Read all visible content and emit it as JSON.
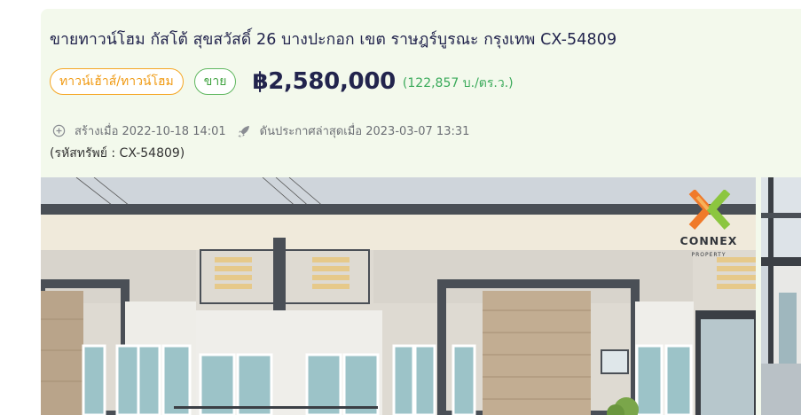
{
  "listing": {
    "title": "ขายทาวน์โฮม กัสโต้ สุขสวัสดิ์ 26 บางปะกอก เขต ราษฎร์บูรณะ กรุงเทพ CX-54809",
    "type_badge": "ทาวน์เฮ้าส์/ทาวน์โฮม",
    "sale_badge": "ขาย",
    "price": "฿2,580,000",
    "price_per_sq": "(122,857 บ./ตร.ว.)",
    "created_label": "สร้างเมื่อ 2022-10-18 14:01",
    "boosted_label": "ดันประกาศล่าสุดเมื่อ 2023-03-07 13:31",
    "property_code": "(รหัสทรัพย์ : CX-54809)",
    "watermark_text": "CONNEX",
    "watermark_sub": "PROPERTY"
  },
  "icons": {
    "created": "plus-circle-icon",
    "boosted": "rocket-icon"
  },
  "colors": {
    "card_bg": "#f3f9ec",
    "title": "#22244d",
    "type_badge": "#f09a12",
    "sale_badge": "#3fa23f",
    "price_per_sq": "#3aaa5a",
    "logo_orange": "#f07a2a",
    "logo_green": "#8cc63f"
  }
}
